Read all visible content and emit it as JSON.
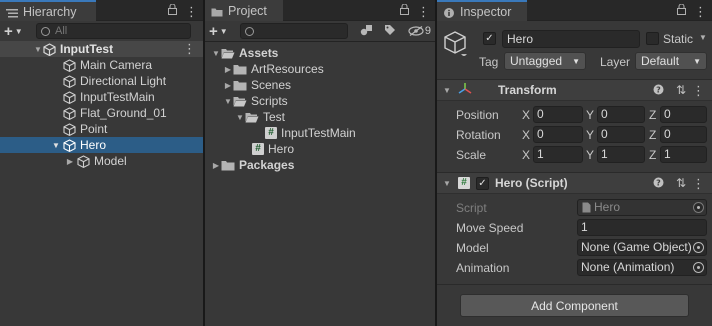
{
  "hierarchy": {
    "tab": "Hierarchy",
    "search_placeholder": "All",
    "scene": "InputTest",
    "items": [
      "Main Camera",
      "Directional Light",
      "InputTestMain",
      "Flat_Ground_01",
      "Point",
      "Hero"
    ],
    "child": "Model"
  },
  "project": {
    "tab": "Project",
    "hidden_count": "9",
    "tree": {
      "assets": "Assets",
      "art": "ArtResources",
      "scenes": "Scenes",
      "scripts": "Scripts",
      "test": "Test",
      "input_main": "InputTestMain",
      "hero": "Hero",
      "packages": "Packages"
    }
  },
  "inspector": {
    "tab": "Inspector",
    "object_name": "Hero",
    "static_label": "Static",
    "tag_label": "Tag",
    "tag_value": "Untagged",
    "layer_label": "Layer",
    "layer_value": "Default",
    "transform": {
      "title": "Transform",
      "position_label": "Position",
      "rotation_label": "Rotation",
      "scale_label": "Scale",
      "axis_x": "X",
      "axis_y": "Y",
      "axis_z": "Z",
      "position": [
        "0",
        "0",
        "0"
      ],
      "rotation": [
        "0",
        "0",
        "0"
      ],
      "scale": [
        "1",
        "1",
        "1"
      ]
    },
    "script": {
      "title": "Hero (Script)",
      "script_label": "Script",
      "script_value": "Hero",
      "move_speed_label": "Move Speed",
      "move_speed_value": "1",
      "model_label": "Model",
      "model_value": "None (Game Object)",
      "animation_label": "Animation",
      "animation_value": "None (Animation)"
    },
    "add_component": "Add Component"
  },
  "colors": {
    "selection": "#2c5d87",
    "accent_tab": "#3a79bb",
    "panel": "#383838"
  }
}
